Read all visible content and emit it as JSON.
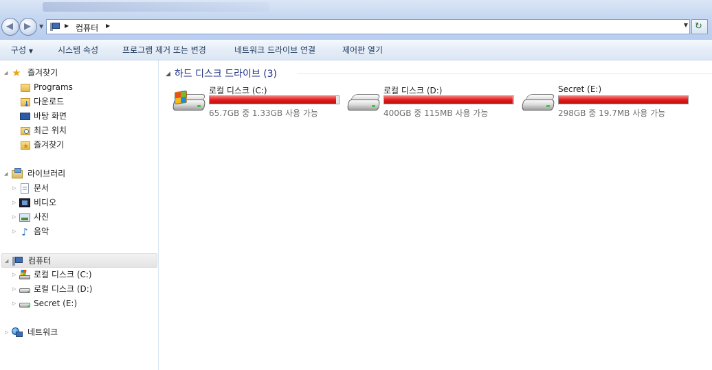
{
  "address": {
    "path": "컴퓨터"
  },
  "toolbar": {
    "organize": "구성",
    "system_properties": "시스템 속성",
    "uninstall": "프로그램 제거 또는 변경",
    "map_drive": "네트워크 드라이브 연결",
    "control_panel": "제어판 열기"
  },
  "navpane": {
    "favorites": {
      "label": "즐겨찾기",
      "items": [
        "Programs",
        "다운로드",
        "바탕 화면",
        "최근 위치",
        "즐겨찾기"
      ]
    },
    "libraries": {
      "label": "라이브러리",
      "items": [
        "문서",
        "비디오",
        "사진",
        "음악"
      ]
    },
    "computer": {
      "label": "컴퓨터",
      "items": [
        "로컬 디스크 (C:)",
        "로컬 디스크 (D:)",
        "Secret (E:)"
      ]
    },
    "network": {
      "label": "네트워크"
    }
  },
  "content": {
    "group_title": "하드 디스크 드라이브 (3)",
    "drives": [
      {
        "name": "로컬 디스크 (C:)",
        "free_text": "65.7GB 중 1.33GB 사용 가능",
        "used_fraction": 0.98
      },
      {
        "name": "로컬 디스크 (D:)",
        "free_text": "400GB 중 115MB 사용 가능",
        "used_fraction": 0.997
      },
      {
        "name": "Secret (E:)",
        "free_text": "298GB 중 19.7MB 사용 가능",
        "used_fraction": 0.999
      }
    ]
  },
  "colors": {
    "bar_full": "#e01b1b",
    "group_title": "#1e3287"
  },
  "icons": {
    "back": "back-arrow-icon",
    "forward": "forward-arrow-icon",
    "refresh": "refresh-icon",
    "drive": "hard-drive-icon",
    "system_drive": "windows-drive-icon"
  }
}
